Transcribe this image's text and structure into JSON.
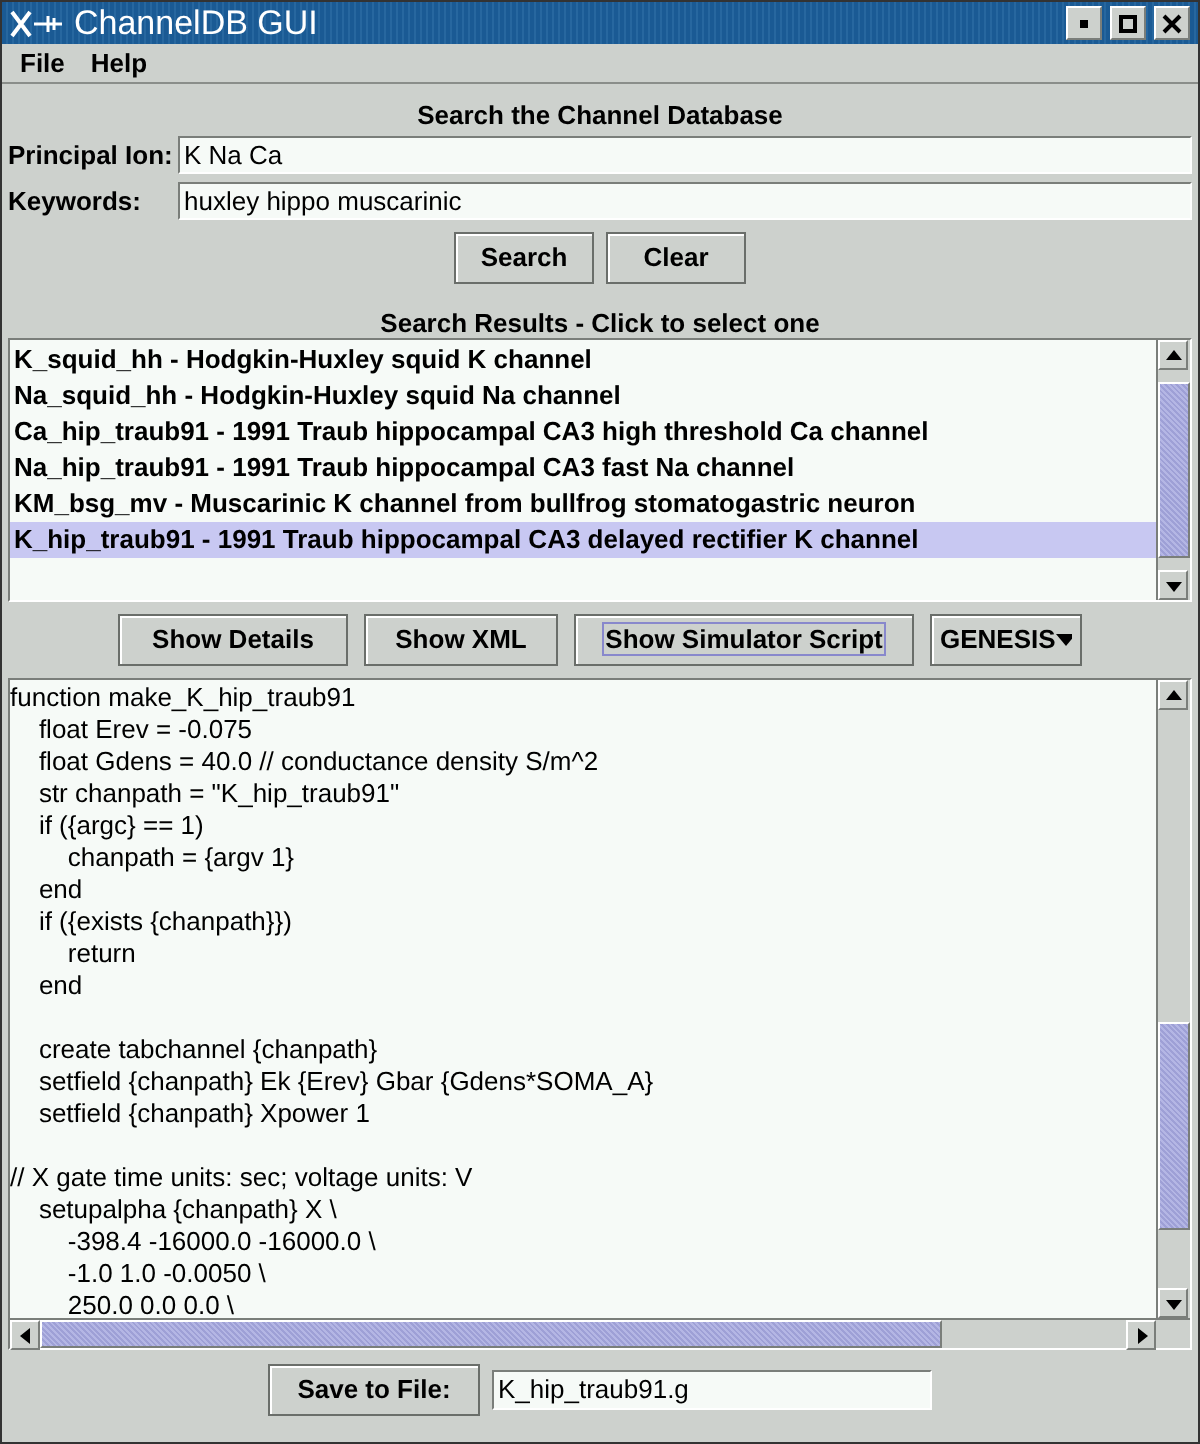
{
  "window": {
    "title": "ChannelDB GUI"
  },
  "menu": [
    "File",
    "Help"
  ],
  "search": {
    "heading": "Search the Channel Database",
    "fields": [
      {
        "label": "Principal Ion:",
        "value": "K Na Ca"
      },
      {
        "label": "Keywords:",
        "value": "huxley hippo muscarinic"
      }
    ],
    "buttons": [
      "Search",
      "Clear"
    ]
  },
  "results": {
    "heading": "Search Results - Click to select one",
    "items": [
      {
        "text": "K_squid_hh - Hodgkin-Huxley squid K channel",
        "selected": false
      },
      {
        "text": "Na_squid_hh - Hodgkin-Huxley squid Na channel",
        "selected": false
      },
      {
        "text": "Ca_hip_traub91 - 1991 Traub hippocampal CA3 high threshold Ca channel",
        "selected": false
      },
      {
        "text": "Na_hip_traub91 - 1991 Traub hippocampal CA3 fast Na channel",
        "selected": false
      },
      {
        "text": "KM_bsg_mv - Muscarinic K channel from bullfrog stomatogastric neuron",
        "selected": false
      },
      {
        "text": "K_hip_traub91 - 1991 Traub hippocampal CA3 delayed rectifier K channel",
        "selected": true
      }
    ]
  },
  "actions": [
    {
      "label": "Show Details",
      "focused": false
    },
    {
      "label": "Show XML",
      "focused": false
    },
    {
      "label": "Show Simulator Script",
      "focused": true
    }
  ],
  "simulator": {
    "value": "GENESIS"
  },
  "script": [
    {
      "kind": "code",
      "text": "function make_K_hip_traub91"
    },
    {
      "kind": "code",
      "text": "    float Erev = -0.075"
    },
    {
      "kind": "code",
      "text": "    float Gdens = 40.0 // conductance density S/m^2"
    },
    {
      "kind": "code",
      "text": "    str chanpath = \"K_hip_traub91\""
    },
    {
      "kind": "code",
      "text": "    if ({argc} == 1)"
    },
    {
      "kind": "code",
      "text": "        chanpath = {argv 1}"
    },
    {
      "kind": "code",
      "text": "    end"
    },
    {
      "kind": "code",
      "text": "    if ({exists {chanpath}})"
    },
    {
      "kind": "code",
      "text": "        return"
    },
    {
      "kind": "code",
      "text": "    end"
    },
    {
      "kind": "blank"
    },
    {
      "kind": "code",
      "text": "    create tabchannel {chanpath}"
    },
    {
      "kind": "code",
      "text": "    setfield {chanpath} Ek {Erev} Gbar {Gdens*SOMA_A}"
    },
    {
      "kind": "code",
      "text": "    setfield {chanpath} Xpower 1"
    },
    {
      "kind": "blank"
    },
    {
      "kind": "code",
      "text": "// X gate time units: sec; voltage units: V"
    },
    {
      "kind": "code",
      "text": "    setupalpha {chanpath} X \\"
    },
    {
      "kind": "code",
      "text": "        -398.4 -16000.0 -16000.0 \\"
    },
    {
      "kind": "code",
      "text": "        -1.0 1.0 -0.0050 \\"
    },
    {
      "kind": "code",
      "text": "        250.0 0.0 0.0 \\"
    }
  ],
  "save": {
    "button": "Save to File:",
    "value": "K_hip_traub91.g"
  }
}
